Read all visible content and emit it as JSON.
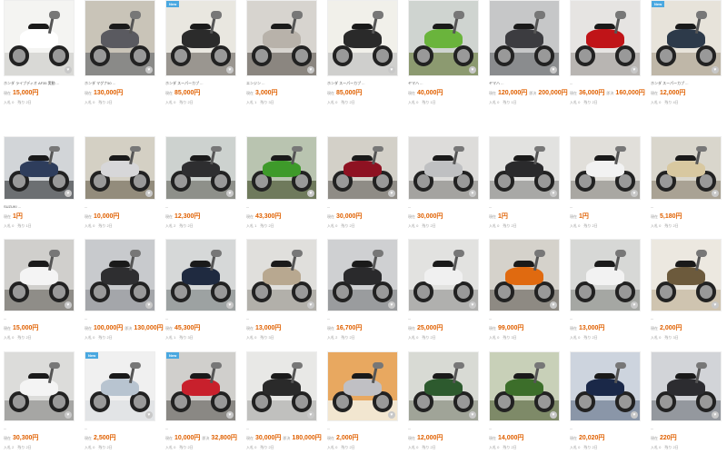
{
  "listings": [
    {
      "title": "ホンダ ライブディオ AF35 実動 ...",
      "price_label": "現在",
      "price": "15,000円",
      "buy_label": "",
      "buy_price": "",
      "meta": "入札 0　残り 2日",
      "new": false,
      "extra": "",
      "colors": [
        "#f4f4f2",
        "#d9d9d6",
        "#ffffff"
      ]
    },
    {
      "title": "ホンダ マグナ50 ...",
      "price_label": "現在",
      "price": "130,000円",
      "buy_label": "",
      "buy_price": "",
      "meta": "入札 0　残り 2日",
      "new": false,
      "extra": "",
      "colors": [
        "#c9c4b8",
        "#8a8a88",
        "#5a5a60"
      ]
    },
    {
      "title": "ホンダ スーパーカブ ...",
      "price_label": "現在",
      "price": "85,000円",
      "buy_label": "",
      "buy_price": "",
      "meta": "入札 0　残り 2日",
      "new": true,
      "extra": "",
      "colors": [
        "#e9e7e0",
        "#9a9690",
        "#2b2b2b"
      ]
    },
    {
      "title": "エンジン ...",
      "price_label": "現在",
      "price": "3,000円",
      "buy_label": "",
      "buy_price": "",
      "meta": "入札 1　残り 3日",
      "new": false,
      "extra": "",
      "colors": [
        "#d7d4cf",
        "#8b8680",
        "#b8b2aa"
      ]
    },
    {
      "title": "ホンダ スーパーカブ ...",
      "price_label": "現在",
      "price": "85,000円",
      "buy_label": "",
      "buy_price": "",
      "meta": "入札 0　残り 2日",
      "new": false,
      "extra": "",
      "colors": [
        "#f1f0ea",
        "#cfcfcd",
        "#2a2a2a"
      ]
    },
    {
      "title": "ヤマハ ...",
      "price_label": "現在",
      "price": "40,000円",
      "buy_label": "",
      "buy_price": "",
      "meta": "入札 0　残り 1日",
      "new": false,
      "extra": "",
      "colors": [
        "#cfd4d0",
        "#8c9a70",
        "#6ab43c"
      ]
    },
    {
      "title": "ヤマハ ...",
      "price_label": "現在",
      "price": "120,000円",
      "buy_label": "即決",
      "buy_price": "200,000円",
      "meta": "入札 0　残り 1日",
      "new": false,
      "extra": "",
      "colors": [
        "#c6c7c8",
        "#8a8c8e",
        "#3c3c40"
      ]
    },
    {
      "title": "...",
      "price_label": "現在",
      "price": "36,000円",
      "buy_label": "即決",
      "buy_price": "160,000円",
      "meta": "入札 0　残り 2日",
      "new": false,
      "extra": "",
      "colors": [
        "#e6e4e2",
        "#b8b5b2",
        "#c01418"
      ]
    },
    {
      "title": "ホンダ スーパーカブ ...",
      "price_label": "現在",
      "price": "12,000円",
      "buy_label": "",
      "buy_price": "",
      "meta": "入札 0　残り 4日",
      "new": true,
      "extra": "",
      "colors": [
        "#e7e3da",
        "#bfb7a8",
        "#2d3a4a"
      ]
    },
    {
      "title": "SUZUKI ...",
      "price_label": "現在",
      "price": "1円",
      "buy_label": "",
      "buy_price": "",
      "meta": "入札 0　残り 1日",
      "new": false,
      "extra": "",
      "colors": [
        "#d2d5d8",
        "#6c6f72",
        "#2e3d5c"
      ]
    },
    {
      "title": "...",
      "price_label": "現在",
      "price": "10,000円",
      "buy_label": "",
      "buy_price": "",
      "meta": "入札 0　残り 2日",
      "new": false,
      "extra": "",
      "colors": [
        "#d4d0c4",
        "#938c7c",
        "#d7d7d9"
      ]
    },
    {
      "title": "...",
      "price_label": "現在",
      "price": "12,300円",
      "buy_label": "",
      "buy_price": "",
      "meta": "入札 2　残り 2日",
      "new": false,
      "extra": "",
      "colors": [
        "#cdd2cf",
        "#8e908a",
        "#2e2e30"
      ]
    },
    {
      "title": "...",
      "price_label": "現在",
      "price": "43,300円",
      "buy_label": "",
      "buy_price": "",
      "meta": "入札 1　残り 2日",
      "new": false,
      "extra": "",
      "colors": [
        "#b9c4b0",
        "#6f7a5c",
        "#3e9a2a"
      ]
    },
    {
      "title": "...",
      "price_label": "現在",
      "price": "30,000円",
      "buy_label": "",
      "buy_price": "",
      "meta": "入札 0　残り 2日",
      "new": false,
      "extra": "",
      "colors": [
        "#d3d0c8",
        "#8f8c86",
        "#8e1222"
      ]
    },
    {
      "title": "...",
      "price_label": "現在",
      "price": "30,000円",
      "buy_label": "",
      "buy_price": "",
      "meta": "入札 0　残り 2日",
      "new": false,
      "extra": "",
      "colors": [
        "#dddcda",
        "#a4a3a0",
        "#bfc0c2"
      ]
    },
    {
      "title": "...",
      "price_label": "現在",
      "price": "1円",
      "buy_label": "",
      "buy_price": "",
      "meta": "入札 0　残り 2日",
      "new": false,
      "extra": "",
      "colors": [
        "#e2e2e0",
        "#a8a8a6",
        "#2a2a2c"
      ]
    },
    {
      "title": "...",
      "price_label": "現在",
      "price": "1円",
      "buy_label": "",
      "buy_price": "",
      "meta": "入札 0　残り 2日",
      "new": false,
      "extra": "",
      "colors": [
        "#e1dfda",
        "#a9a7a2",
        "#f2f2f2"
      ]
    },
    {
      "title": "...",
      "price_label": "現在",
      "price": "5,180円",
      "buy_label": "",
      "buy_price": "",
      "meta": "入札 0　残り 2日",
      "new": false,
      "extra": "",
      "colors": [
        "#d9d6cc",
        "#a9a294",
        "#d8c8a0"
      ]
    },
    {
      "title": "...",
      "price_label": "現在",
      "price": "15,000円",
      "buy_label": "",
      "buy_price": "",
      "meta": "入札 0　残り 2日",
      "new": false,
      "extra": "",
      "colors": [
        "#d0cfcc",
        "#8f8d88",
        "#f4f4f4"
      ]
    },
    {
      "title": "...",
      "price_label": "現在",
      "price": "100,000円",
      "buy_label": "即決",
      "buy_price": "130,000円",
      "meta": "入札 0　残り 2日",
      "new": false,
      "extra": "",
      "colors": [
        "#c8cacd",
        "#a4a6aa",
        "#2e2e30"
      ]
    },
    {
      "title": "...",
      "price_label": "現在",
      "price": "45,300円",
      "buy_label": "",
      "buy_price": "",
      "meta": "入札 1　残り 3日",
      "new": false,
      "extra": "",
      "colors": [
        "#d6d8d8",
        "#9da2a2",
        "#1f2a40"
      ]
    },
    {
      "title": "...",
      "price_label": "現在",
      "price": "13,000円",
      "buy_label": "",
      "buy_price": "",
      "meta": "入札 0　残り 3日",
      "new": false,
      "extra": "",
      "colors": [
        "#e0dfdc",
        "#b2b0aa",
        "#b8a890"
      ]
    },
    {
      "title": "...",
      "price_label": "現在",
      "price": "16,700円",
      "buy_label": "",
      "buy_price": "",
      "meta": "入札 2　残り 2日",
      "new": false,
      "extra": "",
      "colors": [
        "#cfd0d2",
        "#9a9c9e",
        "#2a2a2c"
      ]
    },
    {
      "title": "...",
      "price_label": "現在",
      "price": "25,000円",
      "buy_label": "",
      "buy_price": "",
      "meta": "入札 0　残り 2日",
      "new": false,
      "extra": "",
      "colors": [
        "#e2e2e0",
        "#b0b0ae",
        "#f0f0f0"
      ]
    },
    {
      "title": "...",
      "price_label": "現在",
      "price": "99,000円",
      "buy_label": "",
      "buy_price": "",
      "meta": "入札 0　残り 3日",
      "new": false,
      "extra": "",
      "colors": [
        "#d5d2cb",
        "#8e8a83",
        "#e06a10"
      ]
    },
    {
      "title": "...",
      "price_label": "現在",
      "price": "13,000円",
      "buy_label": "",
      "buy_price": "",
      "meta": "入札 0　残り 2日",
      "new": false,
      "extra": "",
      "colors": [
        "#d7d8d6",
        "#a5a7a3",
        "#f2f2f2"
      ]
    },
    {
      "title": "...",
      "price_label": "現在",
      "price": "2,000円",
      "buy_label": "",
      "buy_price": "",
      "meta": "入札 0　残り 3日",
      "new": false,
      "extra": "",
      "colors": [
        "#ece8e0",
        "#cfc4b0",
        "#6c5a3c"
      ]
    },
    {
      "title": "...",
      "price_label": "現在",
      "price": "30,300円",
      "buy_label": "",
      "buy_price": "",
      "meta": "入札 2　残り 2日",
      "new": false,
      "extra": "",
      "colors": [
        "#dcdcda",
        "#a6a6a4",
        "#f4f4f4"
      ]
    },
    {
      "title": "...",
      "price_label": "現在",
      "price": "2,500円",
      "buy_label": "",
      "buy_price": "",
      "meta": "入札 0　残り 2日",
      "new": true,
      "extra": "",
      "colors": [
        "#f0f0f0",
        "#e2e4e6",
        "#b8c4d0"
      ]
    },
    {
      "title": "...",
      "price_label": "現在",
      "price": "10,000円",
      "buy_label": "即決",
      "buy_price": "32,800円",
      "meta": "入札 0　残り 2日",
      "new": true,
      "extra": "",
      "colors": [
        "#d0cfcc",
        "#8a8884",
        "#c8202c"
      ]
    },
    {
      "title": "...",
      "price_label": "現在",
      "price": "30,000円",
      "buy_label": "即決",
      "buy_price": "180,000円",
      "meta": "入札 0　残り 2日",
      "new": false,
      "extra": "",
      "colors": [
        "#e8e8e6",
        "#c0c0be",
        "#2a2a2a"
      ]
    },
    {
      "title": "...",
      "price_label": "現在",
      "price": "2,000円",
      "buy_label": "",
      "buy_price": "",
      "meta": "入札 0　残り 2日",
      "new": false,
      "extra": "",
      "colors": [
        "#e8a860",
        "#f2e6d0",
        "#c0c0c4"
      ]
    },
    {
      "title": "...",
      "price_label": "現在",
      "price": "12,000円",
      "buy_label": "",
      "buy_price": "",
      "meta": "入札 0　残り 2日",
      "new": false,
      "extra": "",
      "colors": [
        "#d8dad4",
        "#a0a498",
        "#2d5a2e"
      ]
    },
    {
      "title": "...",
      "price_label": "現在",
      "price": "14,000円",
      "buy_label": "",
      "buy_price": "",
      "meta": "入札 0　残り 2日",
      "new": false,
      "extra": "",
      "colors": [
        "#c8d0b8",
        "#7e8a68",
        "#3c6e2a"
      ]
    },
    {
      "title": "...",
      "price_label": "現在",
      "price": "20,020円",
      "buy_label": "",
      "buy_price": "",
      "meta": "入札 0　残り 2日",
      "new": false,
      "extra": "",
      "colors": [
        "#cdd4de",
        "#8a96a8",
        "#1a2848"
      ]
    },
    {
      "title": "...",
      "price_label": "現在",
      "price": "220円",
      "buy_label": "",
      "buy_price": "",
      "meta": "入札 0　残り 2日",
      "new": false,
      "extra": "",
      "colors": [
        "#d2d4d8",
        "#94989e",
        "#2c2c30"
      ]
    }
  ],
  "ui": {
    "new_badge": "New",
    "like_glyph": "♥"
  }
}
